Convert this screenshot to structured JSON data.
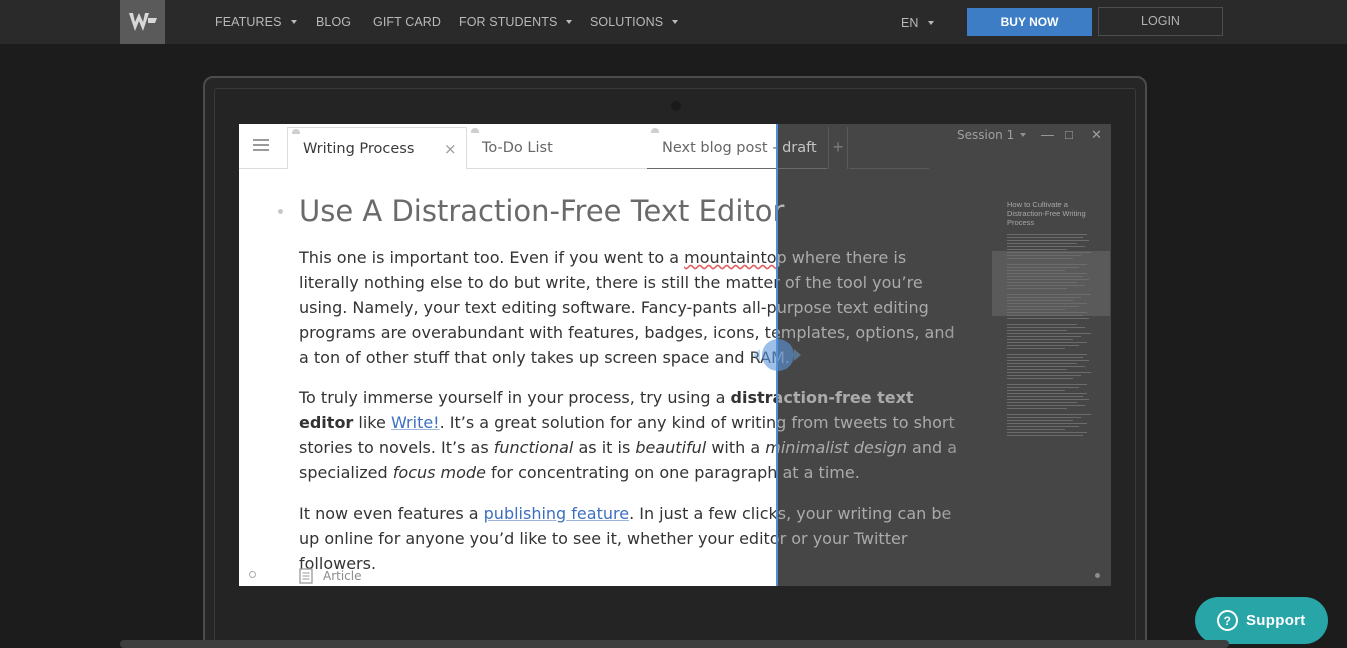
{
  "nav": {
    "logo_icon": "w-logo-icon",
    "items": [
      {
        "label": "FEATURES",
        "has_caret": true
      },
      {
        "label": "BLOG",
        "has_caret": false
      },
      {
        "label": "GIFT CARD",
        "has_caret": false
      },
      {
        "label": "FOR STUDENTS",
        "has_caret": true
      },
      {
        "label": "SOLUTIONS",
        "has_caret": true
      }
    ],
    "language": "EN",
    "buy_label": "BUY NOW",
    "login_label": "LOGIN",
    "accent": "#3d7dc5"
  },
  "editor": {
    "tabs": [
      {
        "label": "Writing Process",
        "active": true
      },
      {
        "label": "To-Do List",
        "active": false
      },
      {
        "label": "Next blog post - draft",
        "active": false
      }
    ],
    "add_tab": "+",
    "close_tab": "×",
    "session_label": "Session 1",
    "title": "Use A Distraction-Free Text Editor",
    "p1": {
      "t1": "This one is important too. Even if you went to a ",
      "spell": "mountaintop",
      "t2": " where there is literally nothing else to do but write, there is still the matter of the tool you’re using. Namely, your text editing software. Fancy-pants all-purpose text editing programs are overabundant with features, badges, icons, templates, options, and a ton of other stuff that only takes up screen space and RAM."
    },
    "p2": {
      "t1": "To truly immerse yourself in your process, try using a ",
      "bold": "distraction-free text editor",
      "t2": " like ",
      "link": "Write!",
      "t3": ". It’s a great solution for any kind of writing from tweets to short stories to novels. It’s as ",
      "i1": "functional",
      "t4": " as it is ",
      "i2": "beautiful",
      "t5": " with a ",
      "i3": "minimalist design",
      "t6": " and a specialized ",
      "i4": "focus mode",
      "t7": " for concentrating on one paragraph at a time."
    },
    "p3": {
      "t1": "It now even features a ",
      "link": "publishing feature",
      "t2": ". In just a few clicks, your writing can be up online for anyone you’d like to see it, whether your editor or your Twitter followers."
    },
    "status": "Article",
    "outline_title": "How to Cultivate a Distraction-Free Writing Process",
    "divider_color": "#4a8fd8"
  },
  "support": {
    "label": "Support",
    "color": "#27a5a7"
  }
}
